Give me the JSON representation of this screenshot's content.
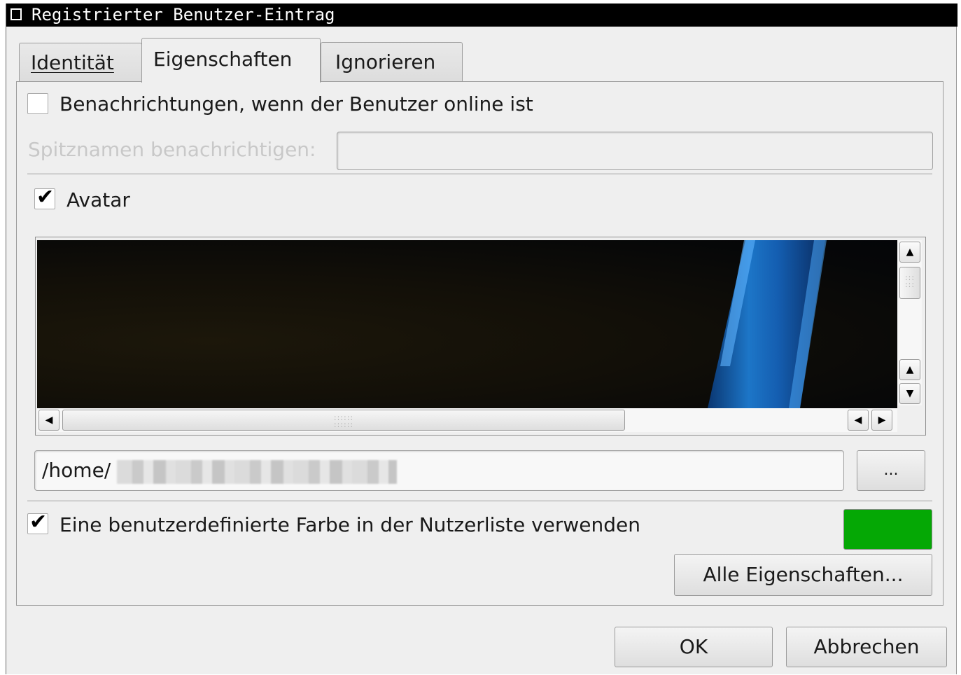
{
  "window": {
    "title": "Registrierter Benutzer-Eintrag"
  },
  "tabs": [
    {
      "label": "Identität",
      "mnemonic": "I"
    },
    {
      "label": "Eigenschaften",
      "mnemonic": "E"
    },
    {
      "label": "Ignorieren",
      "mnemonic": "g"
    }
  ],
  "active_tab": "Eigenschaften",
  "notify": {
    "checkbox_label": "Benachrichtungen, wenn der Benutzer online ist",
    "checked": false,
    "nick_label": "Spitznamen benachrichtigen:",
    "nick_value": ""
  },
  "avatar": {
    "checkbox_label": "Avatar",
    "checked": true,
    "path_value": "/home/",
    "browse_label": "..."
  },
  "color": {
    "checkbox_label": "Eine benutzerdefinierte Farbe in der Nutzerliste verwenden",
    "checked": true,
    "swatch": "#05a805"
  },
  "all_properties_label": "Alle Eigenschaften...",
  "buttons": {
    "ok": "OK",
    "cancel": "Abbrechen"
  },
  "icons": {
    "check": "✔",
    "scroll_up": "▲",
    "scroll_down": "▼",
    "scroll_left": "◀",
    "scroll_right": "▶"
  }
}
